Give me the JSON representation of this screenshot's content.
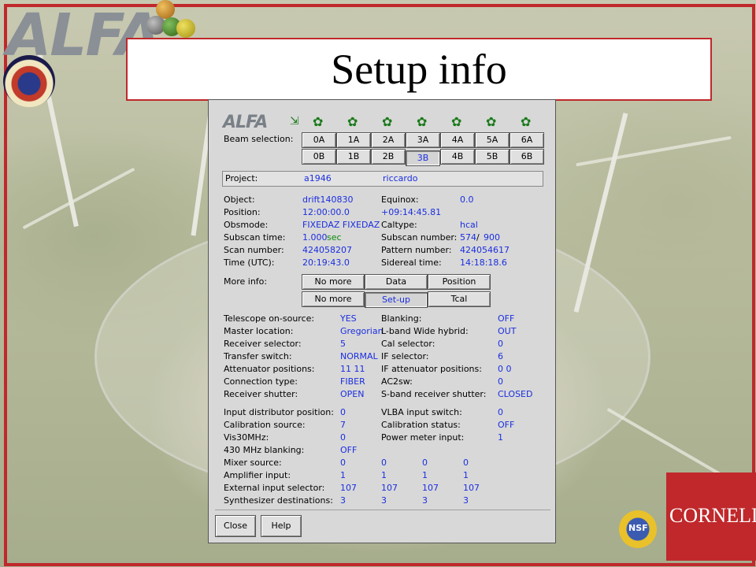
{
  "slide": {
    "title": "Setup info",
    "logo_text": "ALFA",
    "cornell_text": "CORNELL",
    "nsf_text": "NSF"
  },
  "window": {
    "logo_text": "ALFA",
    "beam_icon_glyph": "✿",
    "corner_icon_glyph": "⇲",
    "beam_selection_label": "Beam selection:",
    "beams_top": [
      "0A",
      "1A",
      "2A",
      "3A",
      "4A",
      "5A",
      "6A"
    ],
    "beams_bottom": [
      "0B",
      "1B",
      "2B",
      "3B",
      "4B",
      "5B",
      "6B"
    ],
    "selected_beam": "3B",
    "project_label": "Project:",
    "project_id": "a1946",
    "project_user": "riccardo",
    "info_left": [
      {
        "label": "Object:",
        "value": "drift140830"
      },
      {
        "label": "Position:",
        "value": "12:00:00.0"
      },
      {
        "label": "Obsmode:",
        "value": "FIXEDAZ FIXEDAZ"
      },
      {
        "label": "Subscan time:",
        "value": "1.000",
        "unit": "sec"
      },
      {
        "label": "Scan number:",
        "value": "424058207"
      },
      {
        "label": "Time (UTC):",
        "value": "20:19:43.0"
      }
    ],
    "info_right": [
      {
        "label": "Equinox:",
        "value": "0.0"
      },
      {
        "label": "",
        "value": "+09:14:45.81"
      },
      {
        "label": "Caltype:",
        "value": "hcal"
      },
      {
        "label": "Subscan number:",
        "value": "574",
        "sep": "/",
        "total": "900"
      },
      {
        "label": "Pattern number:",
        "value": "424054617"
      },
      {
        "label": "Sidereal time:",
        "value": "14:18:18.6"
      }
    ],
    "more_info_label": "More info:",
    "more_info_top": [
      "No more",
      "Data",
      "Position"
    ],
    "more_info_bottom": [
      "No more",
      "Set-up",
      "Tcal"
    ],
    "selected_more_info": "Set-up",
    "setup_left": [
      {
        "label": "Telescope on-source:",
        "value": "YES"
      },
      {
        "label": "Master location:",
        "value": "Gregorian"
      },
      {
        "label": "Receiver selector:",
        "value": "5"
      },
      {
        "label": "Transfer switch:",
        "value": "NORMAL"
      },
      {
        "label": "Attenuator positions:",
        "value": "11   11"
      },
      {
        "label": "Connection type:",
        "value": "FIBER"
      },
      {
        "label": "Receiver shutter:",
        "value": "OPEN"
      }
    ],
    "setup_right": [
      {
        "label": "Blanking:",
        "value": "OFF"
      },
      {
        "label": "L-band Wide hybrid:",
        "value": "OUT"
      },
      {
        "label": "Cal selector:",
        "value": "0"
      },
      {
        "label": "IF selector:",
        "value": "6"
      },
      {
        "label": "IF attenuator positions:",
        "value": "0    0"
      },
      {
        "label": "AC2sw:",
        "value": "0"
      },
      {
        "label": "S-band receiver shutter:",
        "value": "CLOSED"
      }
    ],
    "misc_pairs": [
      {
        "l_label": "Input distributor position:",
        "l_value": "0",
        "r_label": "VLBA input switch:",
        "r_value": "0"
      },
      {
        "l_label": "Calibration source:",
        "l_value": "7",
        "r_label": "Calibration status:",
        "r_value": "OFF"
      },
      {
        "l_label": "Vis30MHz:",
        "l_value": "0",
        "r_label": "Power meter input:",
        "r_value": "1"
      },
      {
        "l_label": "430 MHz blanking:",
        "l_value": "OFF",
        "r_label": "",
        "r_value": ""
      }
    ],
    "quad_rows": [
      {
        "label": "Mixer source:",
        "values": [
          "0",
          "0",
          "0",
          "0"
        ]
      },
      {
        "label": "Amplifier input:",
        "values": [
          "1",
          "1",
          "1",
          "1"
        ]
      },
      {
        "label": "External input selector:",
        "values": [
          "107",
          "107",
          "107",
          "107"
        ]
      },
      {
        "label": "Synthesizer destinations:",
        "values": [
          "3",
          "3",
          "3",
          "3"
        ]
      }
    ],
    "close_label": "Close",
    "help_label": "Help"
  }
}
